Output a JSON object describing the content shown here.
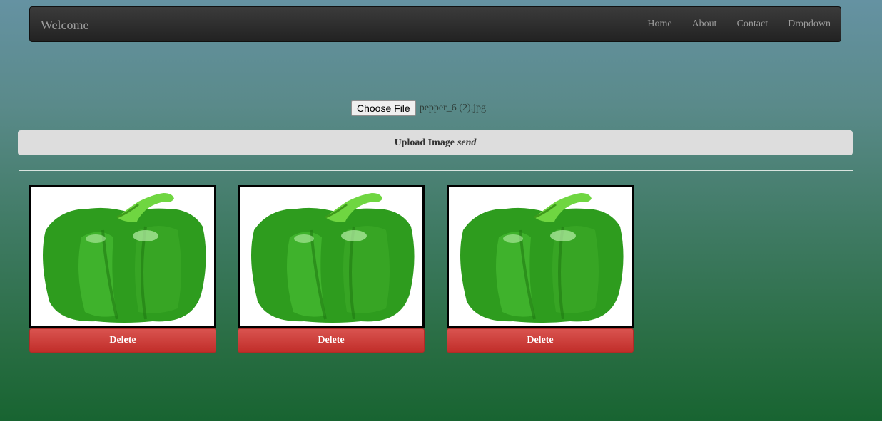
{
  "navbar": {
    "brand": "Welcome",
    "links": [
      "Home",
      "About",
      "Contact",
      "Dropdown"
    ]
  },
  "upload": {
    "choose_label": "Choose File",
    "file_name": "pepper_6 (2).jpg",
    "button_label": "Upload Image",
    "button_suffix": "send"
  },
  "gallery": {
    "items": [
      {
        "delete_label": "Delete",
        "image": "green-pepper"
      },
      {
        "delete_label": "Delete",
        "image": "green-pepper"
      },
      {
        "delete_label": "Delete",
        "image": "green-pepper"
      }
    ]
  }
}
